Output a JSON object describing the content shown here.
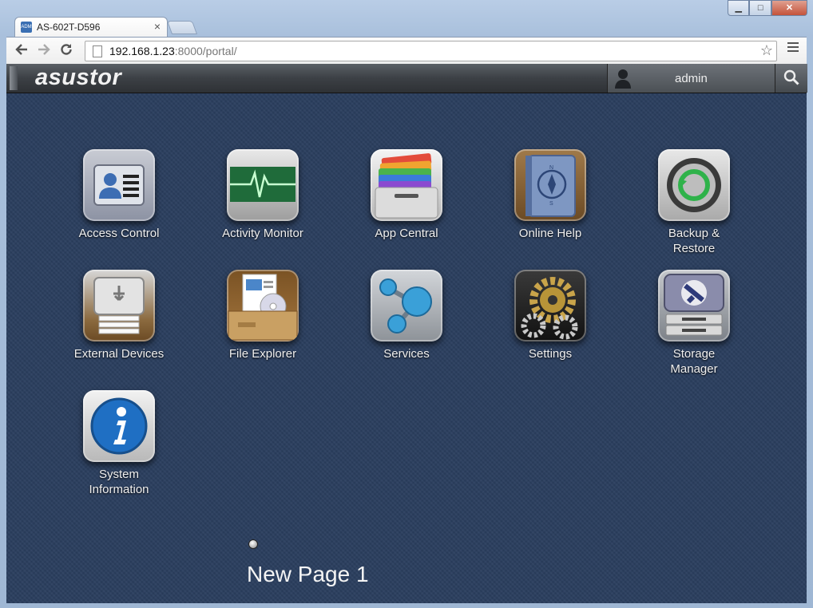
{
  "browser": {
    "tab_title": "AS-602T-D596",
    "tab_close": "×",
    "favicon_text": "ADM",
    "url_host": "192.168.1.23",
    "url_rest": ":8000/portal/",
    "window_buttons": {
      "minimize": "▁",
      "maximize": "□",
      "close": "✕"
    }
  },
  "portal": {
    "logo": "asustor",
    "user_name": "admin",
    "apps": [
      {
        "line1": "Access Control",
        "line2": "",
        "icon": "access-control-icon"
      },
      {
        "line1": "Activity Monitor",
        "line2": "",
        "icon": "activity-monitor-icon"
      },
      {
        "line1": "App Central",
        "line2": "",
        "icon": "app-central-icon"
      },
      {
        "line1": "Online Help",
        "line2": "",
        "icon": "online-help-icon"
      },
      {
        "line1": "Backup &",
        "line2": "Restore",
        "icon": "backup-restore-icon"
      },
      {
        "line1": "External Devices",
        "line2": "",
        "icon": "external-devices-icon"
      },
      {
        "line1": "File Explorer",
        "line2": "",
        "icon": "file-explorer-icon"
      },
      {
        "line1": "Services",
        "line2": "",
        "icon": "services-icon"
      },
      {
        "line1": "Settings",
        "line2": "",
        "icon": "settings-icon"
      },
      {
        "line1": "Storage",
        "line2": "Manager",
        "icon": "storage-manager-icon"
      },
      {
        "line1": "System",
        "line2": "Information",
        "icon": "system-information-icon"
      }
    ],
    "page_name": "New Page 1"
  }
}
